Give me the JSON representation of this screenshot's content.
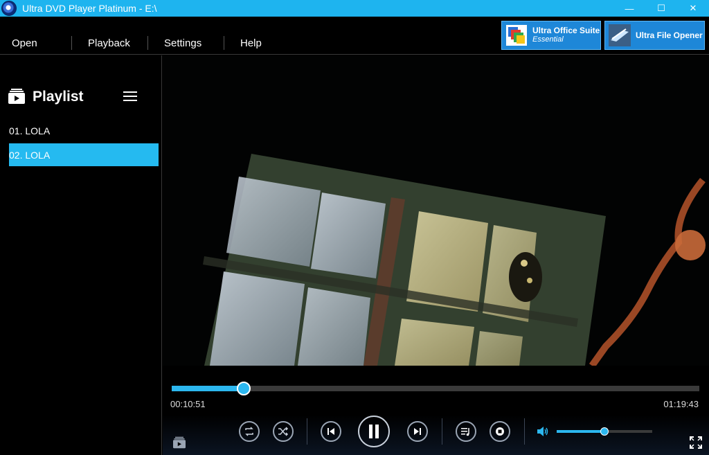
{
  "window": {
    "title": "Ultra DVD Player Platinum - E:\\",
    "minimize_glyph": "—",
    "maximize_glyph": "☐",
    "close_glyph": "✕"
  },
  "menu": {
    "open": "Open",
    "playback": "Playback",
    "settings": "Settings",
    "help": "Help"
  },
  "promos": [
    {
      "title": "Ultra Office Suite",
      "subtitle": "Essential",
      "icon": "office-suite-icon"
    },
    {
      "title": "Ultra File Opener",
      "subtitle": "",
      "icon": "file-opener-icon"
    }
  ],
  "playlist": {
    "title": "Playlist",
    "items": [
      {
        "label": "01. LOLA",
        "active": false
      },
      {
        "label": "02. LOLA",
        "active": true
      }
    ]
  },
  "playback": {
    "elapsed": "00:10:51",
    "duration": "01:19:43",
    "progress_fraction": 0.1361,
    "volume_fraction": 0.5
  },
  "colors": {
    "accent": "#25baf0",
    "titlebar": "#1eb4ef",
    "promo": "#1e87d8"
  }
}
